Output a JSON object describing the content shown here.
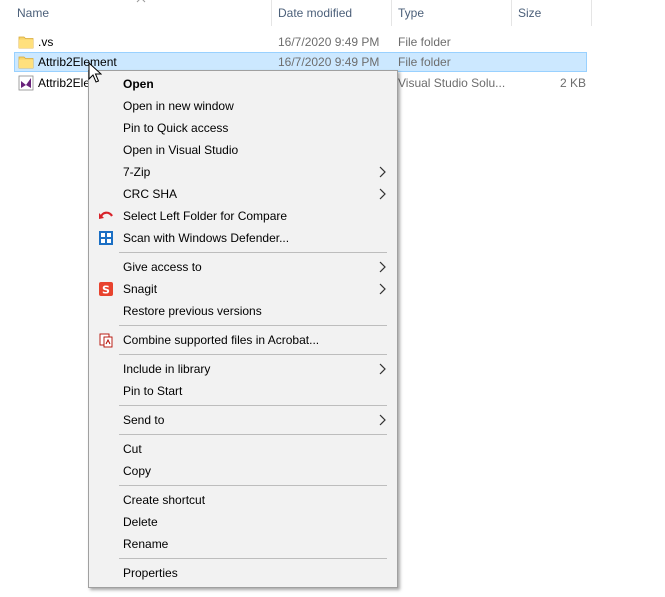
{
  "columns": {
    "name": "Name",
    "date_modified": "Date modified",
    "type": "Type",
    "size": "Size"
  },
  "files": [
    {
      "name": ".vs",
      "date": "16/7/2020 9:49 PM",
      "type": "File folder",
      "size": "",
      "icon": "folder-icon"
    },
    {
      "name": "Attrib2Element",
      "date": "16/7/2020 9:49 PM",
      "type": "File folder",
      "size": "",
      "icon": "folder-icon",
      "selected": true
    },
    {
      "name": "Attrib2Ele",
      "date": "",
      "type": "Visual Studio Solu...",
      "size": "2 KB",
      "icon": "visual-studio-solution-icon"
    }
  ],
  "menu": {
    "open": "Open",
    "open_new_window": "Open in new window",
    "pin_quick_access": "Pin to Quick access",
    "open_visual_studio": "Open in Visual Studio",
    "seven_zip": "7-Zip",
    "crc_sha": "CRC SHA",
    "select_left_folder": "Select Left Folder for Compare",
    "scan_defender": "Scan with Windows Defender...",
    "give_access": "Give access to",
    "snagit": "Snagit",
    "restore_versions": "Restore previous versions",
    "combine_acrobat": "Combine supported files in Acrobat...",
    "include_library": "Include in library",
    "pin_start": "Pin to Start",
    "send_to": "Send to",
    "cut": "Cut",
    "copy": "Copy",
    "create_shortcut": "Create shortcut",
    "delete": "Delete",
    "rename": "Rename",
    "properties": "Properties"
  },
  "colors": {
    "selection_bg": "#cce8ff",
    "selection_border": "#99d1ff",
    "menu_bg": "#f2f2f2",
    "header_text": "#4c607a"
  }
}
